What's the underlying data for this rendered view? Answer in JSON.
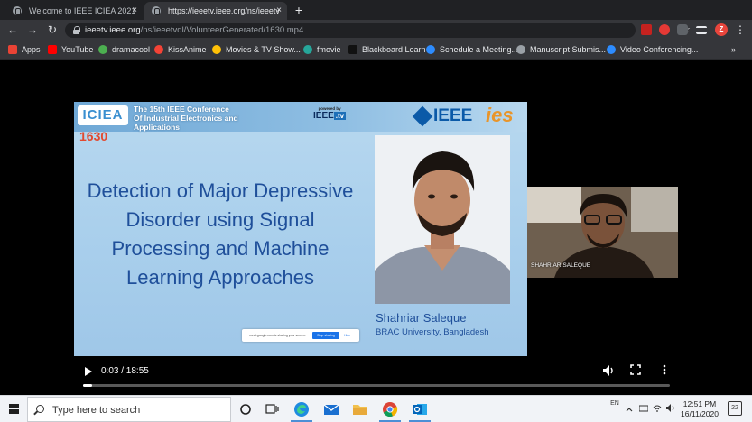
{
  "browser": {
    "tabs": [
      {
        "title": "Welcome to IEEE ICIEA 2021",
        "active": false
      },
      {
        "title": "https://ieeetv.ieee.org/ns/ieeetv",
        "active": true
      }
    ],
    "new_tab": "+",
    "close_glyph": "×",
    "url_host": "ieeetv.ieee.org",
    "url_path": "/ns/ieeetvdl/VolunteerGenerated/1630.mp4",
    "back": "←",
    "forward": "→",
    "reload": "↻",
    "star": "☆",
    "profile_initial": "Z",
    "menu": "⋮"
  },
  "bookmarks": [
    {
      "label": "Apps",
      "icon": "apps-grid-icon",
      "color": "#ea4335"
    },
    {
      "label": "YouTube",
      "icon": "youtube-icon",
      "color": "#ff0000"
    },
    {
      "label": "dramacool",
      "icon": "dramacool-icon",
      "color": "#4caf50"
    },
    {
      "label": "KissAnime",
      "icon": "kissanime-icon",
      "color": "#f44336"
    },
    {
      "label": "Movies & TV Show...",
      "icon": "movies-icon",
      "color": "#ffc107"
    },
    {
      "label": "fmovie",
      "icon": "fmovie-icon",
      "color": "#26a69a"
    },
    {
      "label": "Blackboard Learn",
      "icon": "blackboard-icon",
      "color": "#111111"
    },
    {
      "label": "Schedule a Meeting...",
      "icon": "zoom-icon",
      "color": "#2d8cff"
    },
    {
      "label": "Manuscript Submis...",
      "icon": "manuscript-icon",
      "color": "#9aa0a6"
    },
    {
      "label": "Video Conferencing...",
      "icon": "zoom-icon",
      "color": "#2d8cff"
    }
  ],
  "bookmarks_more": "»",
  "slide": {
    "conf_logo": "ICIEA",
    "paper_id": "1630",
    "conf_title_lines": [
      "The 15th IEEE Conference",
      "Of Industrial Electronics and",
      "Applications"
    ],
    "powered_by": "powered by",
    "ieeetv_word": "IEEE",
    "ieeetv_tv": ".tv",
    "ieee_word": "IEEE",
    "ies_word": "ies",
    "paper_title_lines": [
      "Detection of Major Depressive",
      "Disorder using Signal",
      "Processing and Machine",
      "Learning Approaches"
    ],
    "speaker_name": "Shahriar Saleque",
    "speaker_affiliation": "BRAC University, Bangladesh",
    "share_text": "meet.google.com is sharing your screen.",
    "share_stop": "Stop sharing",
    "share_hide": "Hide"
  },
  "webcam": {
    "label": "SHAHRIAR SALEQUE"
  },
  "player": {
    "time": "0:03 / 18:55",
    "progress": 0.003,
    "volume_icon": "volume-icon",
    "fullscreen_icon": "fullscreen-icon",
    "more_icon": "more-vertical-icon"
  },
  "taskbar": {
    "search_placeholder": "Type here to search",
    "lang": "EN",
    "time": "12:51 PM",
    "date": "16/11/2020",
    "notifications": "22"
  }
}
